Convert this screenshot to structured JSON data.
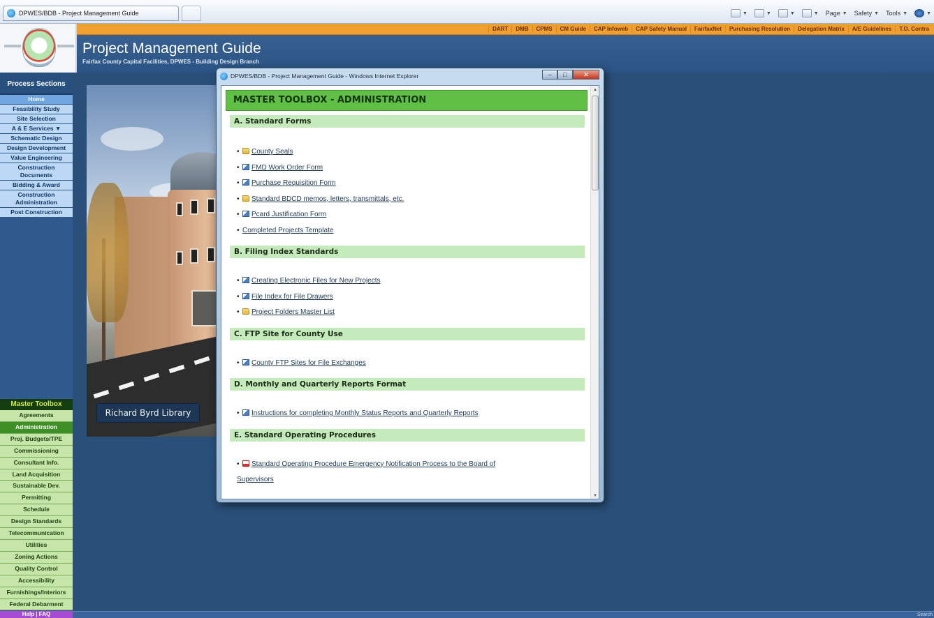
{
  "browser": {
    "tab_title": "DPWES/BDB - Project Management Guide",
    "commands": [
      "Page",
      "Safety",
      "Tools"
    ]
  },
  "header": {
    "quick_links": [
      "DART",
      "DMB",
      "CPMS",
      "CM Guide",
      "CAP Infoweb",
      "CAP Safety Manual",
      "FairfaxNet",
      "Purchasing Resolution",
      "Delegation Matrix",
      "A/E Guidelines",
      "T.O. Contra"
    ],
    "title": "Project Management Guide",
    "subtitle": "Fairfax County Capital Facilities, DPWES - Building Design Branch"
  },
  "left_nav": {
    "heading": "Process Sections",
    "process_items": [
      "Home",
      "Feasibility Study",
      "Site Selection",
      "A & E Services ▼",
      "Schematic Design",
      "Design Development",
      "Value Engineering",
      "Construction Documents",
      "Bidding & Award",
      "Construction Administration",
      "Post Construction"
    ],
    "toolbox_heading": "Master Toolbox",
    "toolbox_items": [
      "Agreements",
      "Administration",
      "Proj. Budgets/TPE",
      "Commissioning",
      "Consultant Info.",
      "Land Acquisition",
      "Sustainable Dev.",
      "Permitting",
      "Schedule",
      "Design Standards",
      "Telecommunication",
      "Utilities",
      "Zoning Actions",
      "Quality Control",
      "Accessibility",
      "Furnishings/Interiors",
      "Federal Debarment"
    ],
    "help_item": "Help | FAQ"
  },
  "photo": {
    "caption": "Richard Byrd Library"
  },
  "popup": {
    "window_title": "DPWES/BDB - Project Management Guide - Windows Internet Explorer",
    "toolbox_title": "MASTER TOOLBOX - ADMINISTRATION",
    "sections": [
      {
        "header": "A. Standard Forms",
        "links": [
          {
            "icon": "folder-icon",
            "text": "County Seals"
          },
          {
            "icon": "word-doc-icon",
            "text": "FMD Work Order Form"
          },
          {
            "icon": "word-doc-icon",
            "text": "Purchase Requisition Form"
          },
          {
            "icon": "folder-icon",
            "text": "Standard BDCD memos, letters, transmittals, etc."
          },
          {
            "icon": "word-doc-icon",
            "text": "Pcard Justification Form"
          },
          {
            "icon": "",
            "text": "Completed Projects Template"
          }
        ]
      },
      {
        "header": "B. Filing Index Standards",
        "links": [
          {
            "icon": "word-doc-icon",
            "text": "Creating Electronic Files for New Projects"
          },
          {
            "icon": "word-doc-icon",
            "text": "File Index for File Drawers"
          },
          {
            "icon": "folder-icon",
            "text": "Project Folders Master List"
          }
        ]
      },
      {
        "header": "C. FTP Site for County Use",
        "links": [
          {
            "icon": "word-doc-icon",
            "text": "County FTP Sites for File Exchanges"
          }
        ]
      },
      {
        "header": "D. Monthly and Quarterly Reports Format",
        "links": [
          {
            "icon": "word-doc-icon",
            "text": "Instructions for completing Monthly Status Reports and Quarterly Reports"
          }
        ]
      },
      {
        "header": "E. Standard Operating Procedures",
        "links": [
          {
            "icon": "pdf-icon",
            "text": "Standard Operating Procedure Emergency Notification Process to the Board of",
            "text2": "Supervisors"
          }
        ]
      }
    ]
  },
  "status_bar": {
    "right_text": "Search"
  },
  "colors": {
    "page_background": "#2a4f78",
    "orange_band": "#f0a030",
    "toolbox_title_green": "#5fc045",
    "section_header_green": "#c5ebbc",
    "active_toolbox_item": "#3d8f26",
    "help_purple": "#a64bd3"
  }
}
